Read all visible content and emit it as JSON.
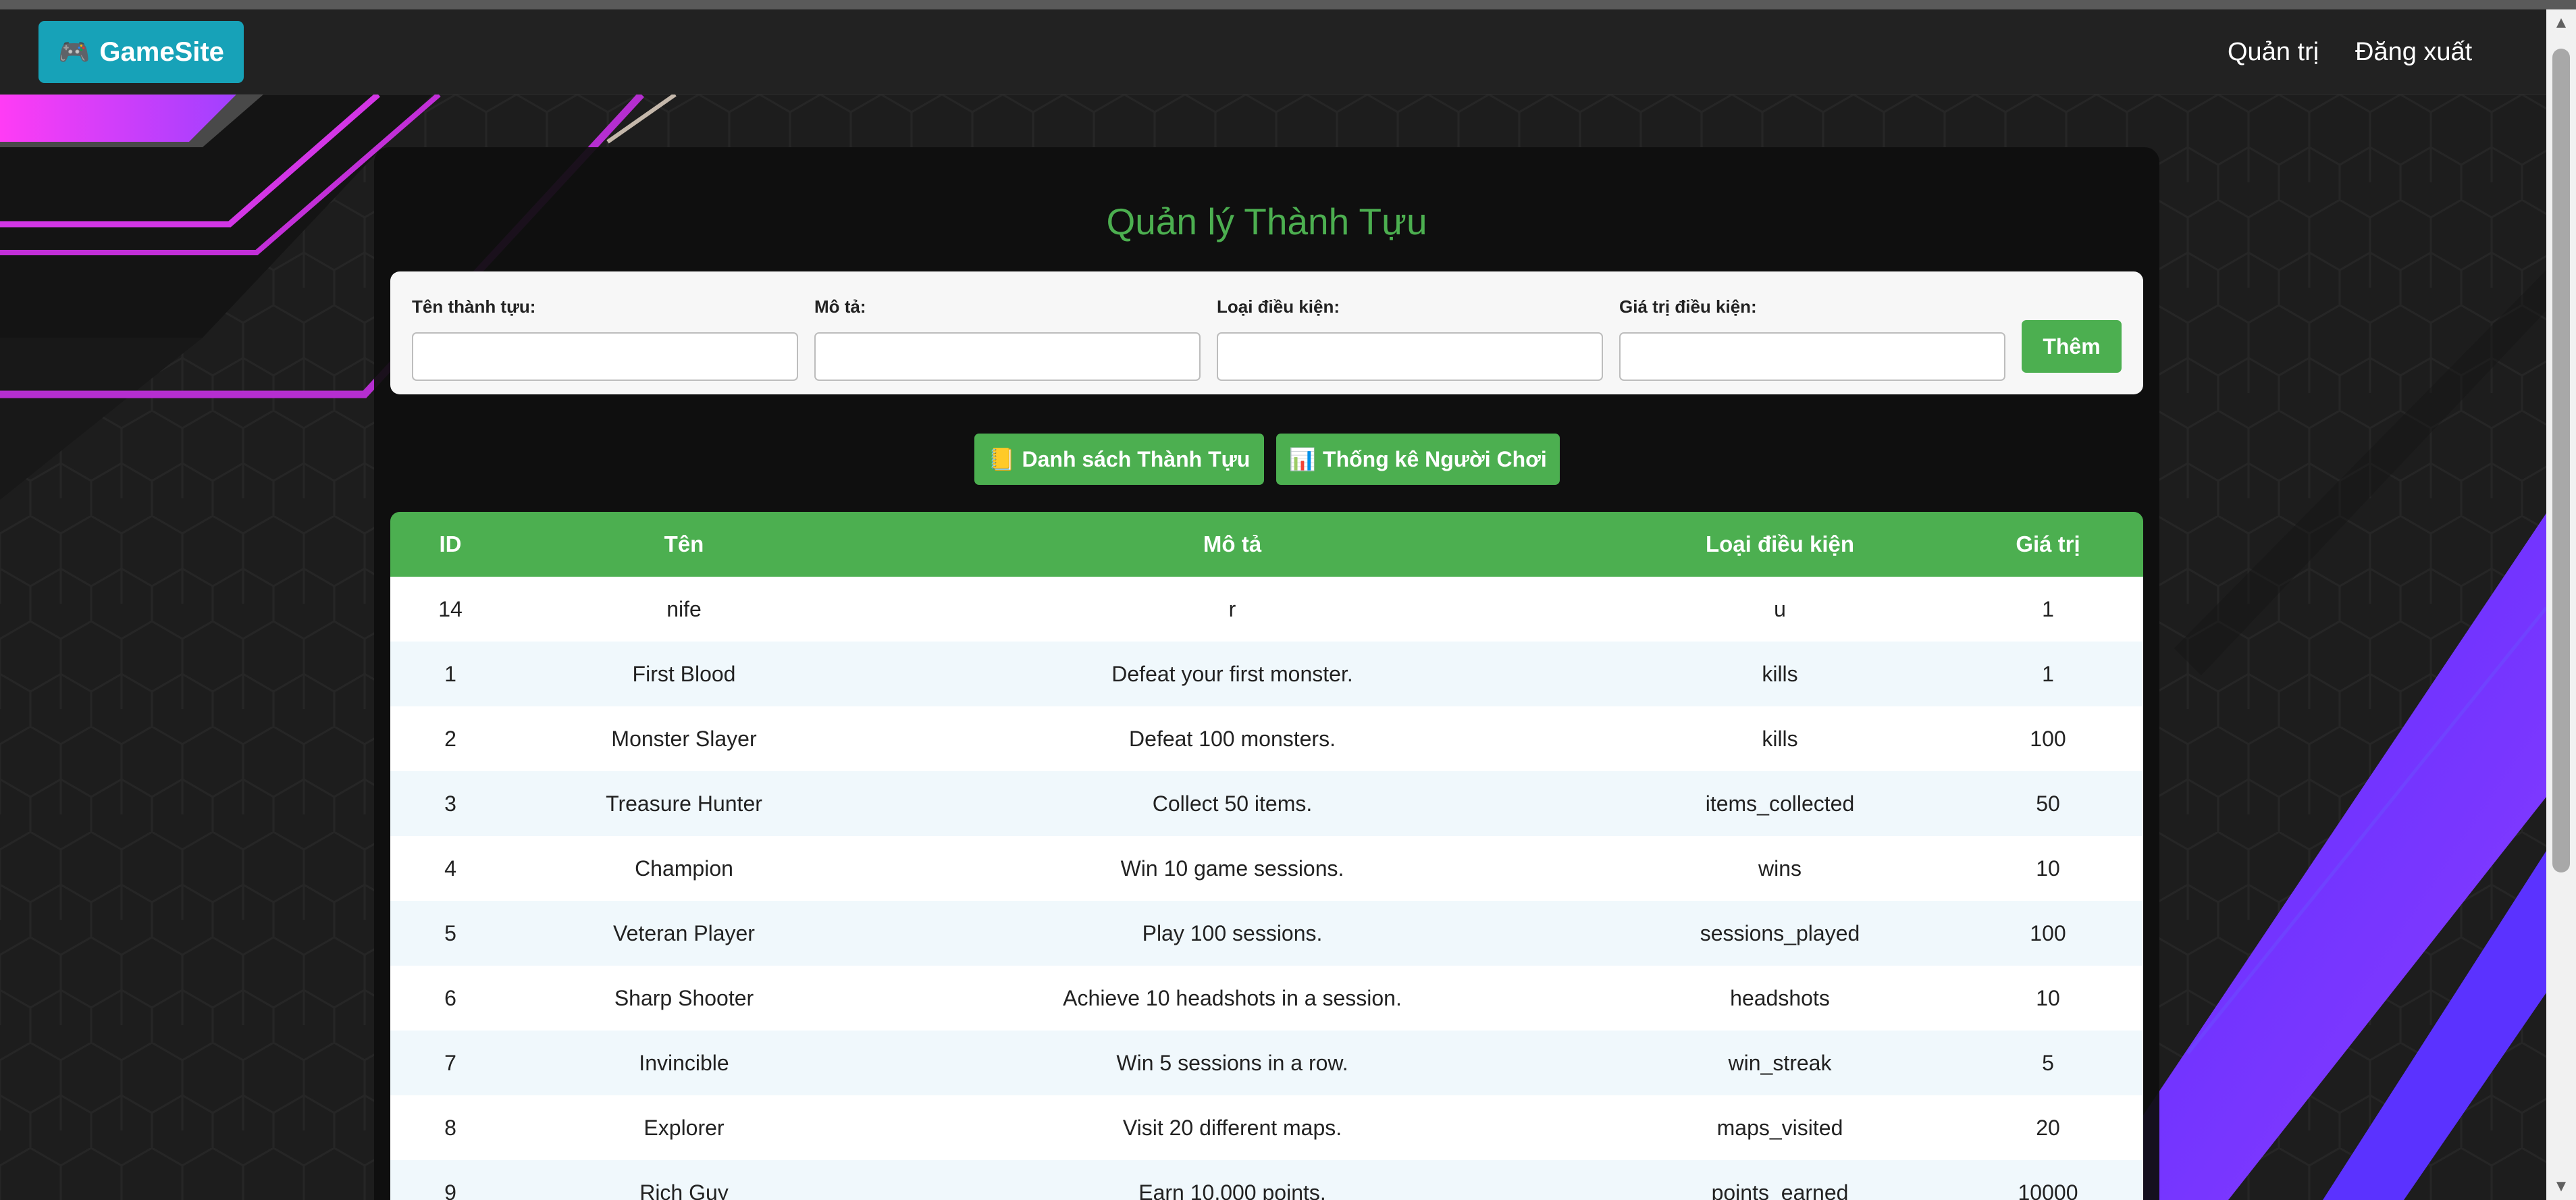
{
  "navbar": {
    "brand_icon": "🎮",
    "brand_label": "GameSite",
    "links": {
      "admin": "Quản trị",
      "logout": "Đăng xuất"
    }
  },
  "page": {
    "title": "Quản lý Thành Tựu"
  },
  "form": {
    "name_label": "Tên thành tựu:",
    "name_value": "",
    "desc_label": "Mô tả:",
    "desc_value": "",
    "condition_type_label": "Loại điều kiện:",
    "condition_type_value": "",
    "condition_value_label": "Giá trị điều kiện:",
    "condition_value_value": "",
    "add_label": "Thêm"
  },
  "toggles": {
    "list_icon": "📒",
    "list_label": "Danh sách Thành Tựu",
    "stats_icon": "📊",
    "stats_label": "Thống kê Người Chơi"
  },
  "table": {
    "headers": [
      "ID",
      "Tên",
      "Mô tả",
      "Loại điều kiện",
      "Giá trị"
    ],
    "rows": [
      [
        "14",
        "nife",
        "r",
        "u",
        "1"
      ],
      [
        "1",
        "First Blood",
        "Defeat your first monster.",
        "kills",
        "1"
      ],
      [
        "2",
        "Monster Slayer",
        "Defeat 100 monsters.",
        "kills",
        "100"
      ],
      [
        "3",
        "Treasure Hunter",
        "Collect 50 items.",
        "items_collected",
        "50"
      ],
      [
        "4",
        "Champion",
        "Win 10 game sessions.",
        "wins",
        "10"
      ],
      [
        "5",
        "Veteran Player",
        "Play 100 sessions.",
        "sessions_played",
        "100"
      ],
      [
        "6",
        "Sharp Shooter",
        "Achieve 10 headshots in a session.",
        "headshots",
        "10"
      ],
      [
        "7",
        "Invincible",
        "Win 5 sessions in a row.",
        "win_streak",
        "5"
      ],
      [
        "8",
        "Explorer",
        "Visit 20 different maps.",
        "maps_visited",
        "20"
      ],
      [
        "9",
        "Rich Guy",
        "Earn 10,000 points.",
        "points_earned",
        "10000"
      ]
    ]
  },
  "colors": {
    "accent_green": "#4caf50",
    "brand_teal": "#17a2b8",
    "navbar_bg": "#222222",
    "stripe_magenta": "#e040fb",
    "stripe_violet": "#7c3aed"
  }
}
